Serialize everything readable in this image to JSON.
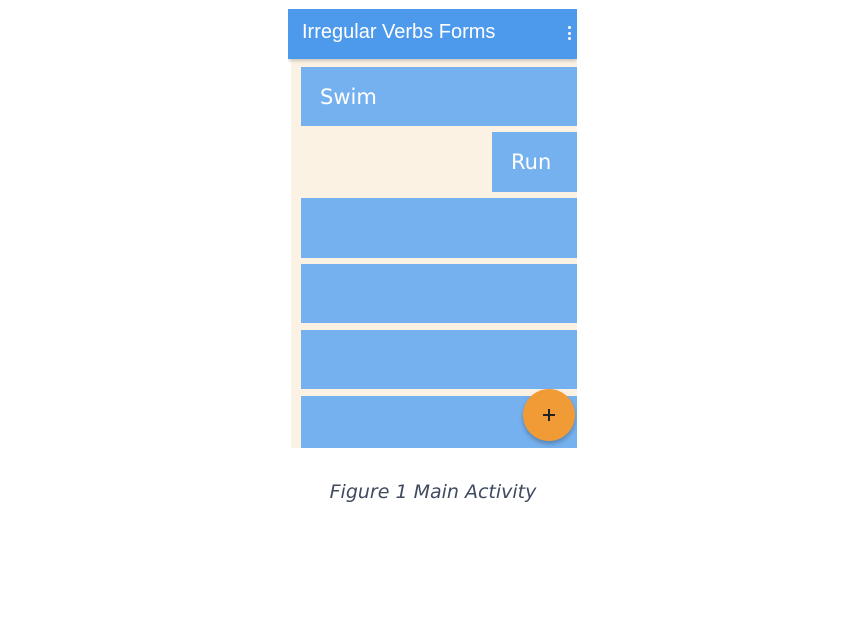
{
  "app_bar": {
    "title": "Irregular Verbs Forms",
    "background_color": "#4d99eb",
    "menu_icon": "overflow-menu-icon"
  },
  "verb_list": {
    "items": [
      {
        "label": "Swim"
      },
      {
        "label": "Run"
      },
      {
        "label": ""
      },
      {
        "label": ""
      },
      {
        "label": ""
      },
      {
        "label": ""
      }
    ],
    "card_color": "#76b1ef",
    "background_color": "#fbf2e4"
  },
  "fab": {
    "icon": "plus-icon",
    "color": "#f09b36"
  },
  "caption": {
    "text": "Figure 1 Main Activity"
  }
}
